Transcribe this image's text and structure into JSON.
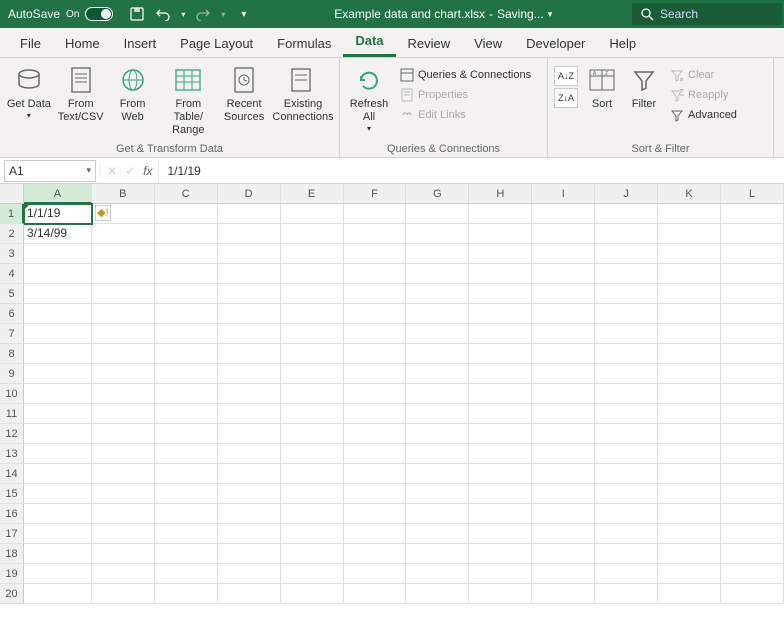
{
  "titlebar": {
    "autosave_label": "AutoSave",
    "autosave_state": "On",
    "filename": "Example data and chart.xlsx",
    "status": "Saving...",
    "search_placeholder": "Search"
  },
  "tabs": [
    "File",
    "Home",
    "Insert",
    "Page Layout",
    "Formulas",
    "Data",
    "Review",
    "View",
    "Developer",
    "Help"
  ],
  "active_tab": "Data",
  "ribbon": {
    "groups": [
      {
        "label": "Get & Transform Data",
        "buttons": [
          "Get Data",
          "From Text/CSV",
          "From Web",
          "From Table/ Range",
          "Recent Sources",
          "Existing Connections"
        ]
      },
      {
        "label": "Queries & Connections",
        "refresh": "Refresh All",
        "items": [
          "Queries & Connections",
          "Properties",
          "Edit Links"
        ]
      },
      {
        "label": "Sort & Filter",
        "sort": "Sort",
        "filter": "Filter",
        "items": [
          "Clear",
          "Reapply",
          "Advanced"
        ]
      }
    ]
  },
  "formula_bar": {
    "name_box": "A1",
    "formula": "1/1/19"
  },
  "grid": {
    "columns": [
      "A",
      "B",
      "C",
      "D",
      "E",
      "F",
      "G",
      "H",
      "I",
      "J",
      "K",
      "L"
    ],
    "active_col": "A",
    "active_row": 1,
    "row_count": 20,
    "cells": {
      "A1": "1/1/19",
      "A2": "3/14/99"
    },
    "error_indicator_cell": "A1"
  },
  "colors": {
    "brand": "#217346"
  }
}
